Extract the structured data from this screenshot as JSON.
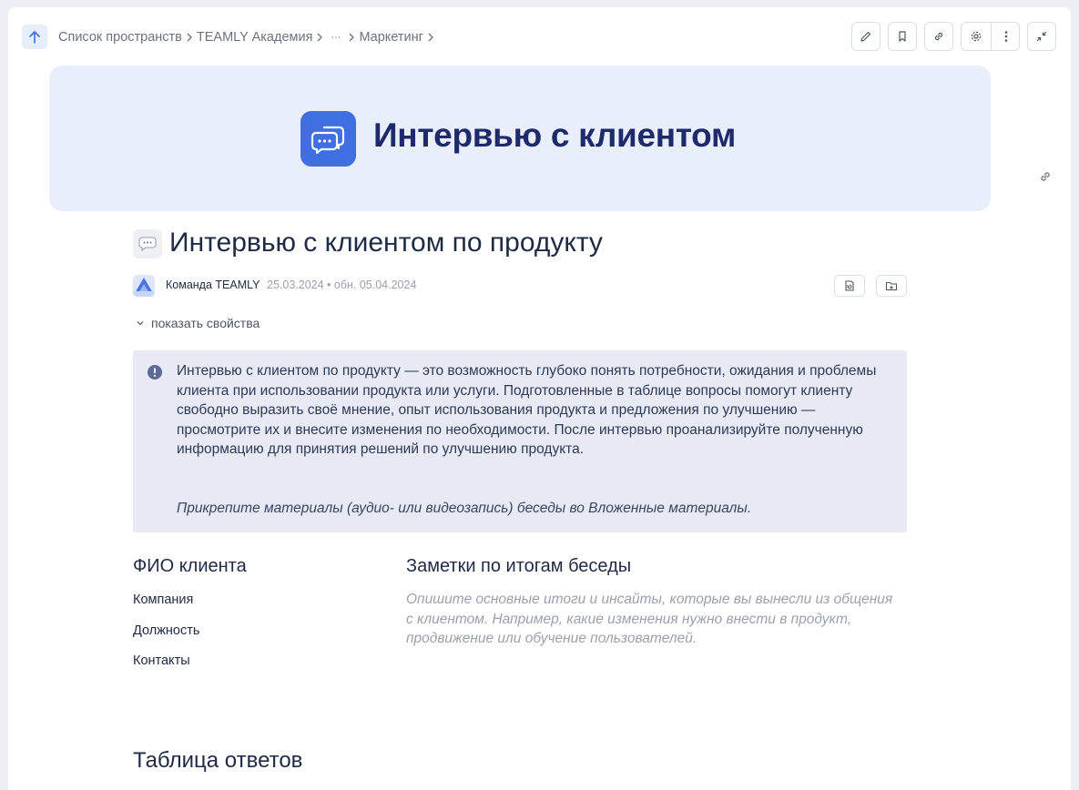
{
  "breadcrumb": {
    "items": [
      "Список пространств",
      "TEAMLY Академия",
      "···",
      "Маркетинг"
    ]
  },
  "toolbar": {
    "icons": [
      "pencil-icon",
      "bookmark-icon",
      "link-icon",
      "gear-icon",
      "more-vertical-icon",
      "collapse-icon"
    ]
  },
  "banner": {
    "title": "Интервью с клиентом",
    "icon": "chat-bubbles-icon"
  },
  "page": {
    "title": "Интервью с клиентом по продукту",
    "author": "Команда TEAMLY",
    "dates": "25.03.2024 • обн. 05.04.2024",
    "show_properties": "показать свойства"
  },
  "callout": {
    "text": "Интервью с клиентом по продукту — это возможность глубоко понять потребности, ожидания и проблемы клиента при использовании продукта или услуги. Подготовленные в таблице вопросы помогут клиенту свободно выразить своё мнение, опыт использования продукта и предложения по улучшению — просмотрите их и внесите изменения по необходимости. После интервью проанализируйте полученную информацию для принятия решений по улучшению продукта.",
    "note": "Прикрепите материалы (аудио- или видеозапись) беседы во Вложенные материалы."
  },
  "client": {
    "heading": "ФИО клиента",
    "fields": [
      "Компания",
      "Должность",
      "Контакты"
    ]
  },
  "notes": {
    "heading": "Заметки по итогам беседы",
    "placeholder": "Опишите основные итоги и инсайты, которые вы вынесли из общения с клиентом. Например, какие изменения нужно внести в продукт, продвижение или обучение пользователей."
  },
  "answers": {
    "heading": "Таблица ответов"
  },
  "colors": {
    "accent": "#3f6fe0",
    "banner_bg": "#e9eefb",
    "callout_bg": "#e7eaf5",
    "title_dark": "#1e2a6b"
  }
}
